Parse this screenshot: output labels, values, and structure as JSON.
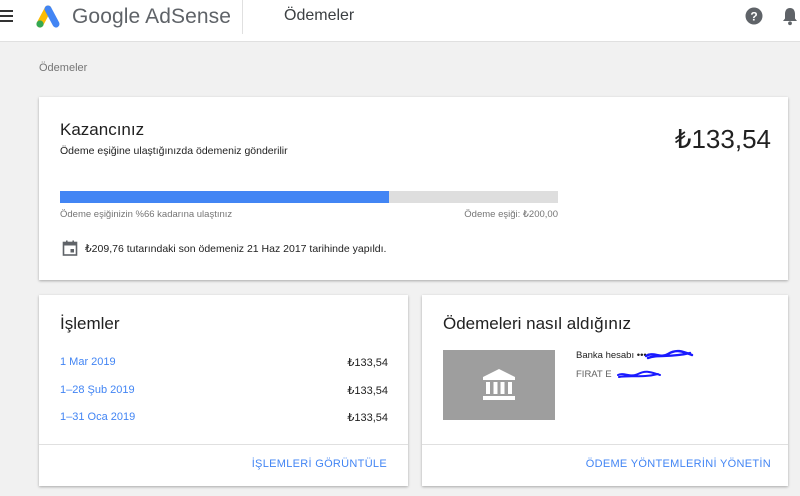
{
  "header": {
    "brand": "Google AdSense",
    "page_title": "Ödemeler",
    "icons": [
      "menu-icon",
      "adsense-logo",
      "help-icon",
      "notifications-icon"
    ]
  },
  "breadcrumb": "Ödemeler",
  "earnings": {
    "title": "Kazancınız",
    "subtitle": "Ödeme eşiğine ulaştığınızda ödemeniz gönderilir",
    "amount": "₺133,54",
    "progress_percent": 66,
    "progress_label": "Ödeme eşiğinizin %66 kadarına ulaştınız",
    "threshold_label": "Ödeme eşiği: ₺200,00",
    "last_payment": "₺209,76 tutarındaki son ödemeniz 21 Haz 2017 tarihinde yapıldı."
  },
  "transactions": {
    "title": "İşlemler",
    "rows": [
      {
        "date": "1 Mar 2019",
        "amount": "₺133,54"
      },
      {
        "date": "1–28 Şub 2019",
        "amount": "₺133,54"
      },
      {
        "date": "1–31 Oca 2019",
        "amount": "₺133,54"
      }
    ],
    "action": "İŞLEMLERİ GÖRÜNTÜLE"
  },
  "payment_method": {
    "title": "Ödemeleri nasıl aldığınız",
    "bank_label": "Banka hesabı ••••",
    "bank_name": "FIRAT E",
    "action": "ÖDEME YÖNTEMLERİNİ YÖNETİN"
  },
  "colors": {
    "accent": "#4285f4",
    "progress_track": "#dedede",
    "bank_box": "#9e9e9e",
    "redaction": "#1a1aff"
  }
}
